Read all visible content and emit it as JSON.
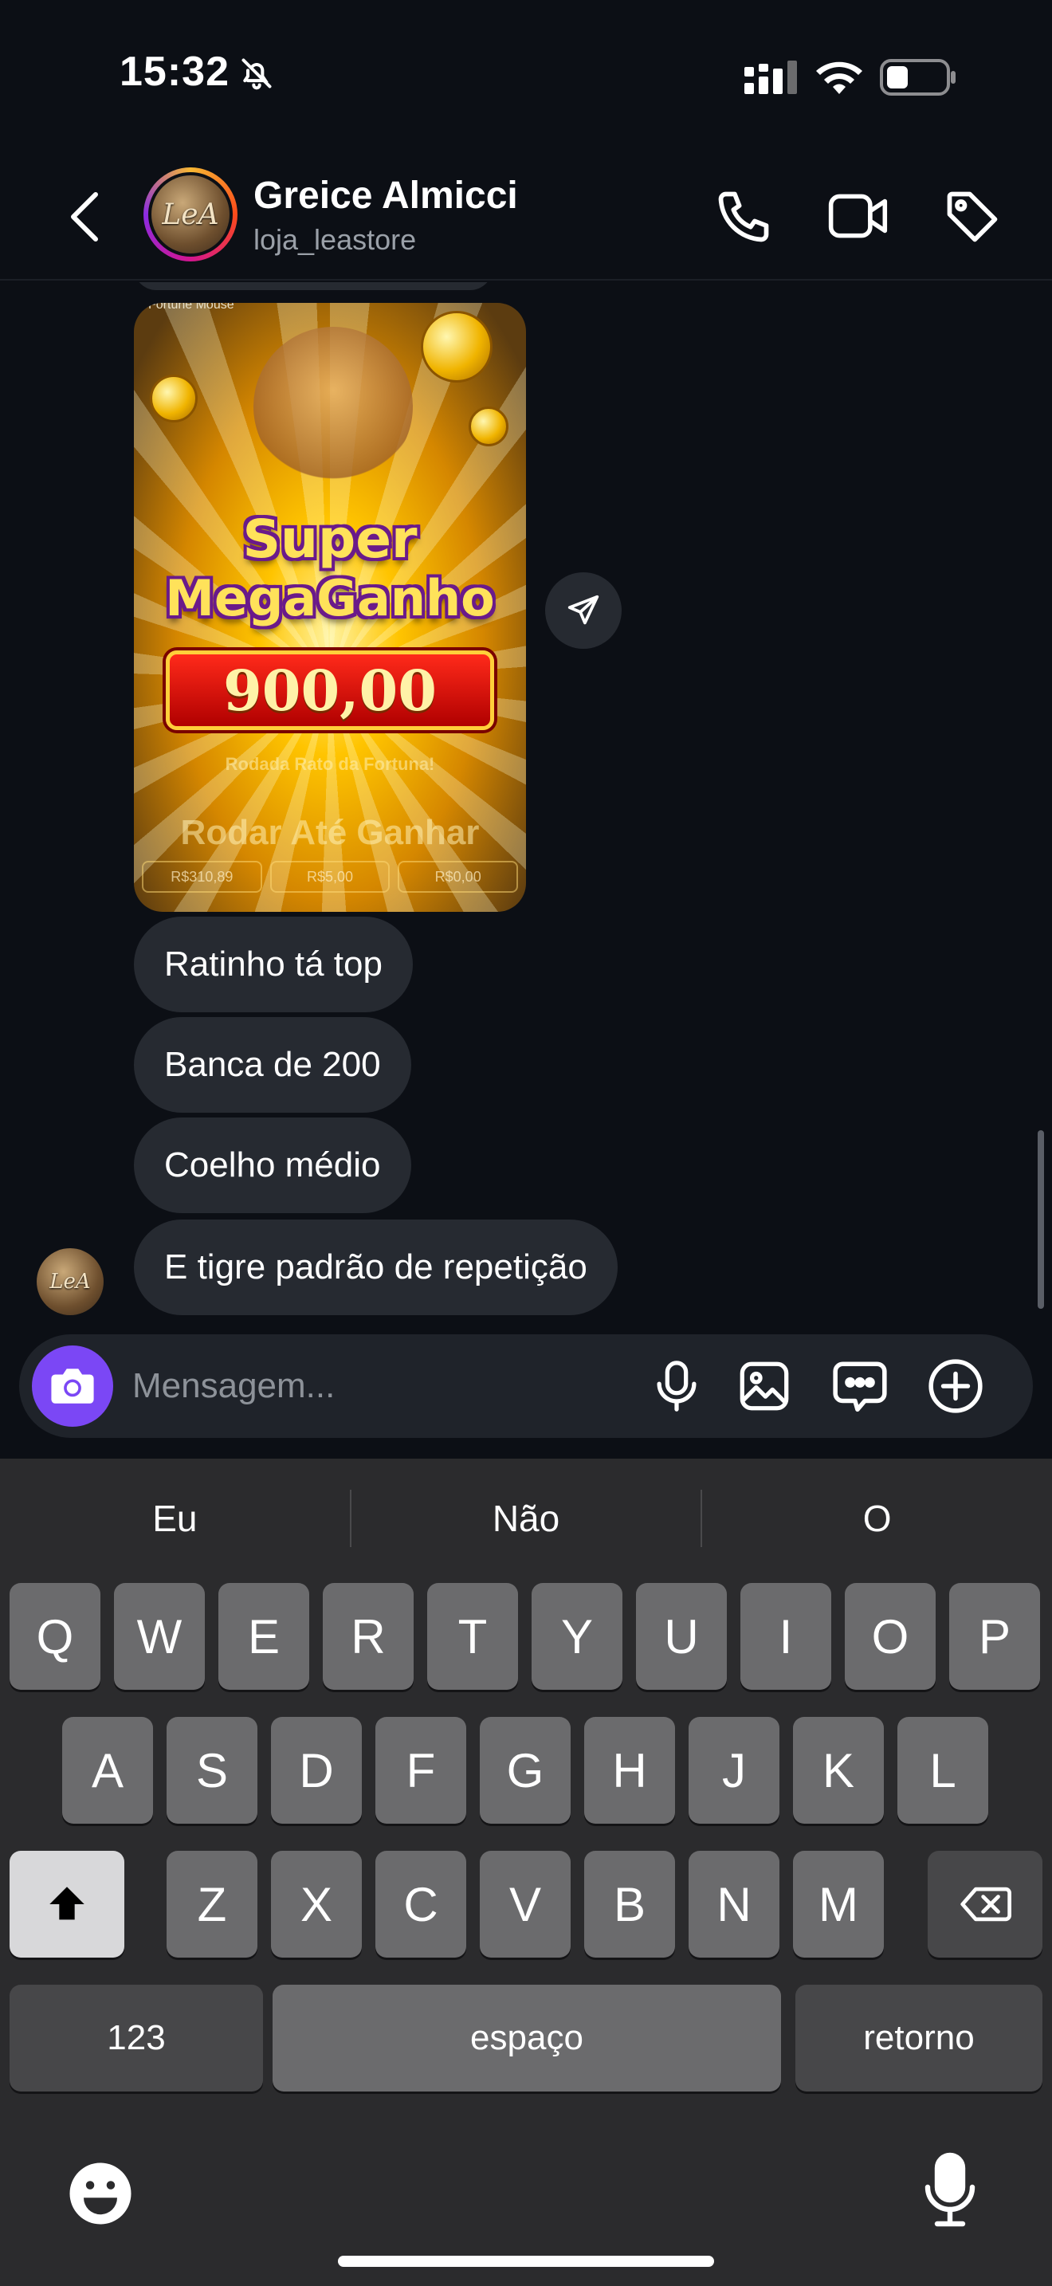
{
  "status": {
    "time": "15:32"
  },
  "header": {
    "name": "Greice Almicci",
    "handle": "loja_leastore",
    "avatar_text": "LeA"
  },
  "media": {
    "top_label": "Fortune Mouse",
    "title_line1": "Super",
    "title_line2": "MegaGanho",
    "amount": "900,00",
    "subtitle": "Rodada Rato da Fortuna!",
    "spin_text": "Rodar Até Ganhar",
    "stats": [
      "R$310,89",
      "R$5,00",
      "R$0,00"
    ]
  },
  "messages": [
    {
      "text": "Ratinho tá top"
    },
    {
      "text": "Banca de 200"
    },
    {
      "text": "Coelho médio"
    },
    {
      "text": "E tigre padrão de repetição"
    }
  ],
  "composer": {
    "placeholder": "Mensagem..."
  },
  "keyboard": {
    "suggestions": [
      "Eu",
      "Não",
      "O"
    ],
    "row1": [
      "Q",
      "W",
      "E",
      "R",
      "T",
      "Y",
      "U",
      "I",
      "O",
      "P"
    ],
    "row2": [
      "A",
      "S",
      "D",
      "F",
      "G",
      "H",
      "J",
      "K",
      "L"
    ],
    "row3": [
      "Z",
      "X",
      "C",
      "V",
      "B",
      "N",
      "M"
    ],
    "numbers_label": "123",
    "space_label": "espaço",
    "return_label": "retorno"
  },
  "colors": {
    "accent": "#7b47f5",
    "bubble": "#262a31",
    "background": "#0c0f15"
  },
  "icons": [
    "bell-slash-icon",
    "signal-icon",
    "wifi-icon",
    "battery-icon",
    "back-icon",
    "phone-icon",
    "video-icon",
    "tag-icon",
    "send-icon",
    "camera-icon",
    "microphone-icon",
    "gallery-icon",
    "sticker-icon",
    "plus-icon",
    "shift-icon",
    "backspace-icon",
    "emoji-icon",
    "dictation-icon"
  ]
}
